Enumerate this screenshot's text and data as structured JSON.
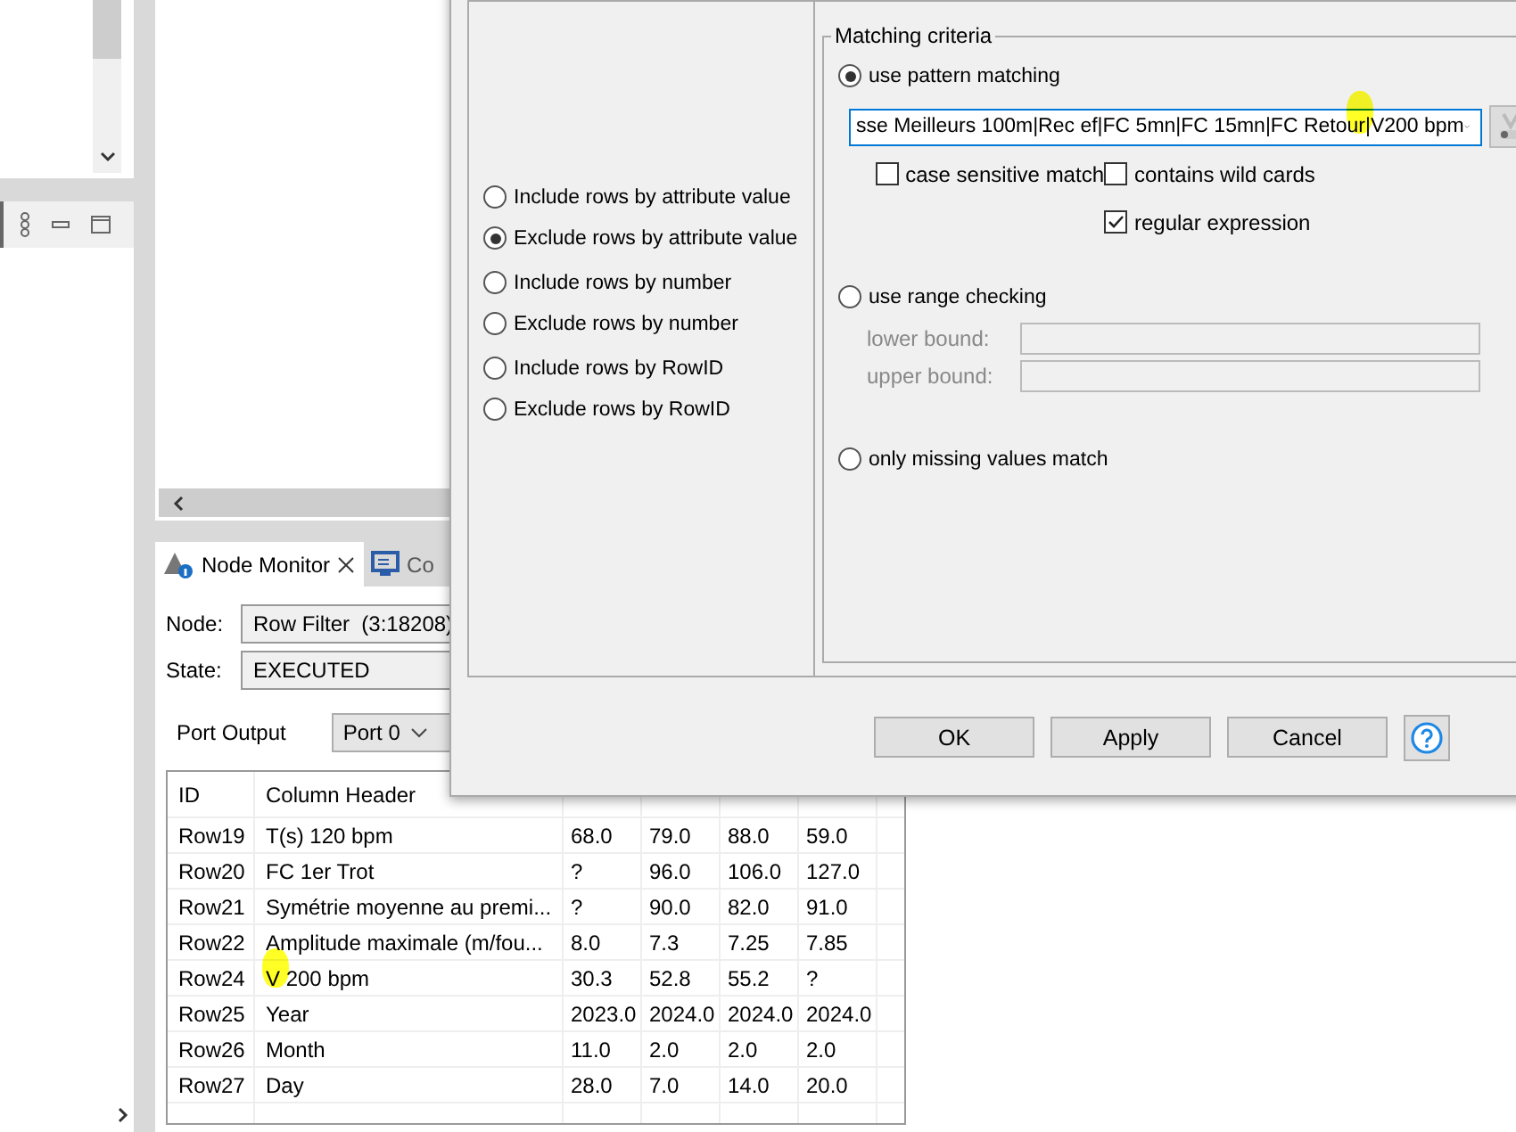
{
  "node_monitor": {
    "tabs": [
      {
        "label": "Node Monitor",
        "selected": true,
        "kind": "monitor"
      },
      {
        "label": "Co",
        "selected": false,
        "kind": "console"
      }
    ],
    "node": {
      "label": "Node:",
      "value": "Row Filter  (3:18208)"
    },
    "state": {
      "label": "State:",
      "value": "EXECUTED"
    },
    "port_output": {
      "label": "Port Output",
      "value": "Port 0"
    },
    "table": {
      "columns": [
        "ID",
        "Column Header"
      ],
      "rows": [
        [
          "Row19",
          "T(s) 120 bpm",
          "68.0",
          "79.0",
          "88.0",
          "59.0"
        ],
        [
          "Row20",
          "FC 1er Trot",
          "?",
          "96.0",
          "106.0",
          "127.0"
        ],
        [
          "Row21",
          "Symétrie moyenne au premi...",
          "?",
          "90.0",
          "82.0",
          "91.0"
        ],
        [
          "Row22",
          "Amplitude maximale (m/fou...",
          "8.0",
          "7.3",
          "7.25",
          "7.85"
        ],
        [
          "Row24",
          "V 200 bpm",
          "30.3",
          "52.8",
          "55.2",
          "?"
        ],
        [
          "Row25",
          "Year",
          "2023.0",
          "2024.0",
          "2024.0",
          "2024.0"
        ],
        [
          "Row26",
          "Month",
          "11.0",
          "2.0",
          "2.0",
          "2.0"
        ],
        [
          "Row27",
          "Day",
          "28.0",
          "7.0",
          "14.0",
          "20.0"
        ]
      ]
    }
  },
  "dialog": {
    "filter_modes": [
      {
        "label": "Include rows by attribute value",
        "selected": false
      },
      {
        "label": "Exclude rows by attribute value",
        "selected": true
      },
      {
        "label": "Include rows by number",
        "selected": false
      },
      {
        "label": "Exclude rows by number",
        "selected": false
      },
      {
        "label": "Include rows by RowID",
        "selected": false
      },
      {
        "label": "Exclude rows by RowID",
        "selected": false
      }
    ],
    "matching_criteria": {
      "title": "Matching criteria",
      "pattern": {
        "label": "use pattern matching",
        "selected": true,
        "value": "sse Meilleurs 100m|Rec ef|FC 5mn|FC 15mn|FC Retour|V200 bpm",
        "options": [
          {
            "label": "case sensitive match",
            "checked": false
          },
          {
            "label": "contains wild cards",
            "checked": false
          },
          {
            "label": "regular expression",
            "checked": true
          }
        ]
      },
      "range": {
        "label": "use range checking",
        "selected": false,
        "disabled": true,
        "lower_label": "lower bound:",
        "upper_label": "upper bound:"
      },
      "missing": {
        "label": "only missing values match",
        "selected": false
      }
    },
    "buttons": [
      "OK",
      "Apply",
      "Cancel"
    ]
  }
}
